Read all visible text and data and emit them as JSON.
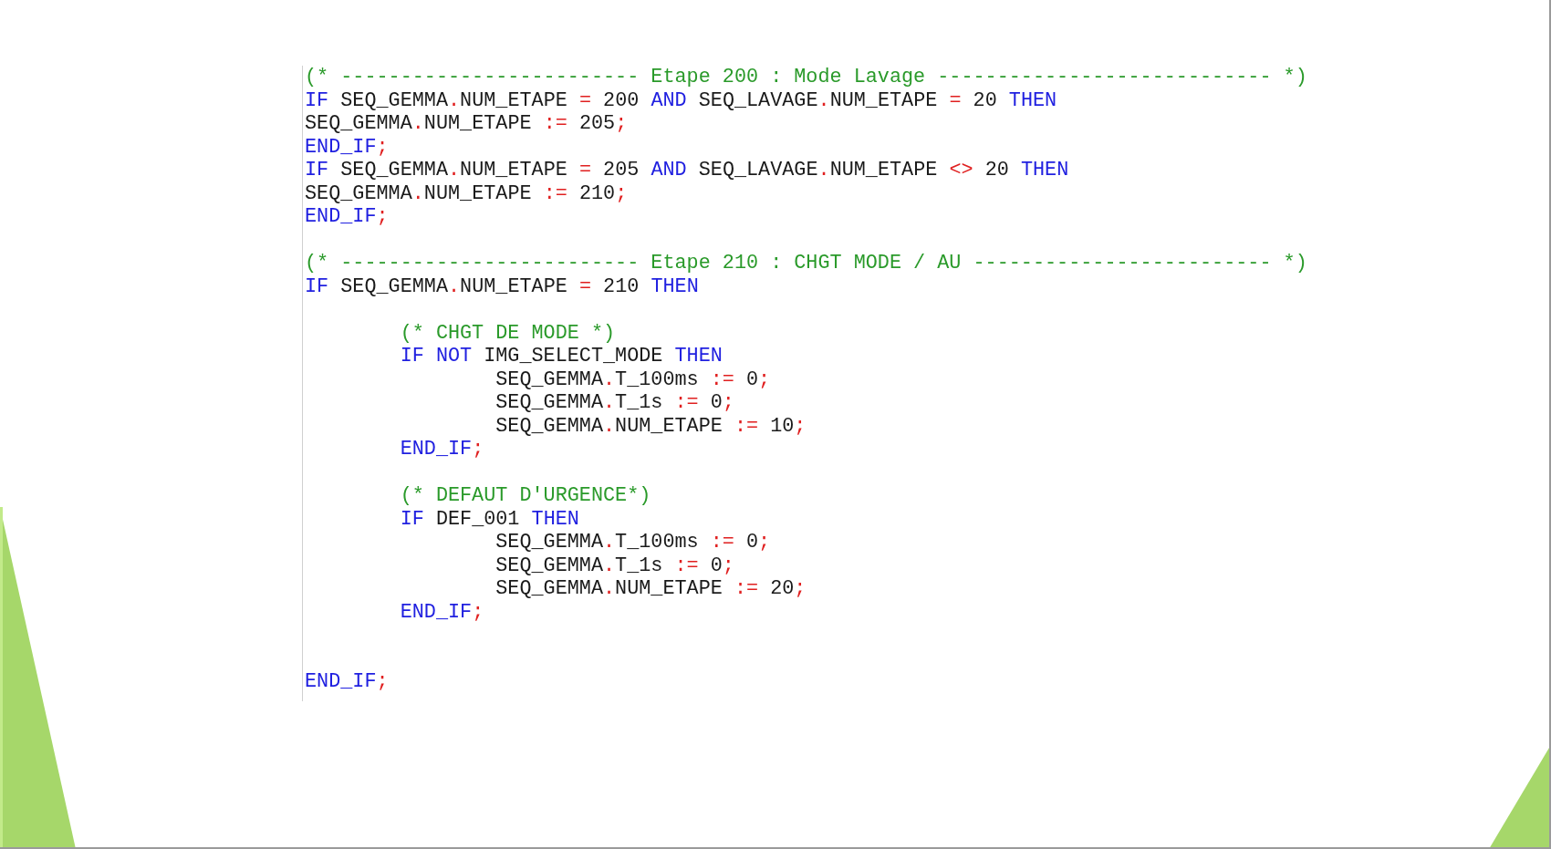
{
  "code_lines": [
    {
      "kind": "code",
      "tokens": [
        {
          "kind": "comment",
          "text": "(* ------------------------- Etape 200 : Mode Lavage ---------------------------- *)"
        }
      ]
    },
    {
      "kind": "code",
      "tokens": [
        {
          "kind": "keyword",
          "text": "IF"
        },
        {
          "kind": "plain",
          "text": " SEQ_GEMMA"
        },
        {
          "kind": "operator",
          "text": "."
        },
        {
          "kind": "plain",
          "text": "NUM_ETAPE "
        },
        {
          "kind": "operator",
          "text": "="
        },
        {
          "kind": "plain",
          "text": " 200 "
        },
        {
          "kind": "keyword",
          "text": "AND"
        },
        {
          "kind": "plain",
          "text": " SEQ_LAVAGE"
        },
        {
          "kind": "operator",
          "text": "."
        },
        {
          "kind": "plain",
          "text": "NUM_ETAPE "
        },
        {
          "kind": "operator",
          "text": "="
        },
        {
          "kind": "plain",
          "text": " 20 "
        },
        {
          "kind": "keyword",
          "text": "THEN"
        }
      ]
    },
    {
      "kind": "code",
      "tokens": [
        {
          "kind": "plain",
          "text": "SEQ_GEMMA"
        },
        {
          "kind": "operator",
          "text": "."
        },
        {
          "kind": "plain",
          "text": "NUM_ETAPE "
        },
        {
          "kind": "operator",
          "text": ":="
        },
        {
          "kind": "plain",
          "text": " 205"
        },
        {
          "kind": "operator",
          "text": ";"
        }
      ]
    },
    {
      "kind": "code",
      "tokens": [
        {
          "kind": "keyword",
          "text": "END_IF"
        },
        {
          "kind": "operator",
          "text": ";"
        }
      ]
    },
    {
      "kind": "code",
      "tokens": [
        {
          "kind": "keyword",
          "text": "IF"
        },
        {
          "kind": "plain",
          "text": " SEQ_GEMMA"
        },
        {
          "kind": "operator",
          "text": "."
        },
        {
          "kind": "plain",
          "text": "NUM_ETAPE "
        },
        {
          "kind": "operator",
          "text": "="
        },
        {
          "kind": "plain",
          "text": " 205 "
        },
        {
          "kind": "keyword",
          "text": "AND"
        },
        {
          "kind": "plain",
          "text": " SEQ_LAVAGE"
        },
        {
          "kind": "operator",
          "text": "."
        },
        {
          "kind": "plain",
          "text": "NUM_ETAPE "
        },
        {
          "kind": "operator",
          "text": "<>"
        },
        {
          "kind": "plain",
          "text": " 20 "
        },
        {
          "kind": "keyword",
          "text": "THEN"
        }
      ]
    },
    {
      "kind": "code",
      "tokens": [
        {
          "kind": "plain",
          "text": "SEQ_GEMMA"
        },
        {
          "kind": "operator",
          "text": "."
        },
        {
          "kind": "plain",
          "text": "NUM_ETAPE "
        },
        {
          "kind": "operator",
          "text": ":="
        },
        {
          "kind": "plain",
          "text": " 210"
        },
        {
          "kind": "operator",
          "text": ";"
        }
      ]
    },
    {
      "kind": "code",
      "tokens": [
        {
          "kind": "keyword",
          "text": "END_IF"
        },
        {
          "kind": "operator",
          "text": ";"
        }
      ]
    },
    {
      "kind": "blank"
    },
    {
      "kind": "code",
      "tokens": [
        {
          "kind": "comment",
          "text": "(* ------------------------- Etape 210 : CHGT MODE / AU ------------------------- *)"
        }
      ]
    },
    {
      "kind": "code",
      "tokens": [
        {
          "kind": "keyword",
          "text": "IF"
        },
        {
          "kind": "plain",
          "text": " SEQ_GEMMA"
        },
        {
          "kind": "operator",
          "text": "."
        },
        {
          "kind": "plain",
          "text": "NUM_ETAPE "
        },
        {
          "kind": "operator",
          "text": "="
        },
        {
          "kind": "plain",
          "text": " 210 "
        },
        {
          "kind": "keyword",
          "text": "THEN"
        }
      ]
    },
    {
      "kind": "blank"
    },
    {
      "kind": "code",
      "tokens": [
        {
          "kind": "comment",
          "text": "        (* CHGT DE MODE *)"
        }
      ]
    },
    {
      "kind": "code",
      "tokens": [
        {
          "kind": "keyword",
          "text": "        IF NOT"
        },
        {
          "kind": "plain",
          "text": " IMG_SELECT_MODE "
        },
        {
          "kind": "keyword",
          "text": "THEN"
        }
      ]
    },
    {
      "kind": "code",
      "tokens": [
        {
          "kind": "plain",
          "text": "                SEQ_GEMMA"
        },
        {
          "kind": "operator",
          "text": "."
        },
        {
          "kind": "plain",
          "text": "T_100ms "
        },
        {
          "kind": "operator",
          "text": ":="
        },
        {
          "kind": "plain",
          "text": " 0"
        },
        {
          "kind": "operator",
          "text": ";"
        }
      ]
    },
    {
      "kind": "code",
      "tokens": [
        {
          "kind": "plain",
          "text": "                SEQ_GEMMA"
        },
        {
          "kind": "operator",
          "text": "."
        },
        {
          "kind": "plain",
          "text": "T_1s "
        },
        {
          "kind": "operator",
          "text": ":="
        },
        {
          "kind": "plain",
          "text": " 0"
        },
        {
          "kind": "operator",
          "text": ";"
        }
      ]
    },
    {
      "kind": "code",
      "tokens": [
        {
          "kind": "plain",
          "text": "                SEQ_GEMMA"
        },
        {
          "kind": "operator",
          "text": "."
        },
        {
          "kind": "plain",
          "text": "NUM_ETAPE "
        },
        {
          "kind": "operator",
          "text": ":="
        },
        {
          "kind": "plain",
          "text": " 10"
        },
        {
          "kind": "operator",
          "text": ";"
        }
      ]
    },
    {
      "kind": "code",
      "tokens": [
        {
          "kind": "keyword",
          "text": "        END_IF"
        },
        {
          "kind": "operator",
          "text": ";"
        }
      ]
    },
    {
      "kind": "blank"
    },
    {
      "kind": "code",
      "tokens": [
        {
          "kind": "comment",
          "text": "        (* DEFAUT D'URGENCE*)"
        }
      ]
    },
    {
      "kind": "code",
      "tokens": [
        {
          "kind": "keyword",
          "text": "        IF"
        },
        {
          "kind": "plain",
          "text": " DEF_001 "
        },
        {
          "kind": "keyword",
          "text": "THEN"
        }
      ]
    },
    {
      "kind": "code",
      "tokens": [
        {
          "kind": "plain",
          "text": "                SEQ_GEMMA"
        },
        {
          "kind": "operator",
          "text": "."
        },
        {
          "kind": "plain",
          "text": "T_100ms "
        },
        {
          "kind": "operator",
          "text": ":="
        },
        {
          "kind": "plain",
          "text": " 0"
        },
        {
          "kind": "operator",
          "text": ";"
        }
      ]
    },
    {
      "kind": "code",
      "tokens": [
        {
          "kind": "plain",
          "text": "                SEQ_GEMMA"
        },
        {
          "kind": "operator",
          "text": "."
        },
        {
          "kind": "plain",
          "text": "T_1s "
        },
        {
          "kind": "operator",
          "text": ":="
        },
        {
          "kind": "plain",
          "text": " 0"
        },
        {
          "kind": "operator",
          "text": ";"
        }
      ]
    },
    {
      "kind": "code",
      "tokens": [
        {
          "kind": "plain",
          "text": "                SEQ_GEMMA"
        },
        {
          "kind": "operator",
          "text": "."
        },
        {
          "kind": "plain",
          "text": "NUM_ETAPE "
        },
        {
          "kind": "operator",
          "text": ":="
        },
        {
          "kind": "plain",
          "text": " 20"
        },
        {
          "kind": "operator",
          "text": ";"
        }
      ]
    },
    {
      "kind": "code",
      "tokens": [
        {
          "kind": "keyword",
          "text": "        END_IF"
        },
        {
          "kind": "operator",
          "text": ";"
        }
      ]
    },
    {
      "kind": "blank"
    },
    {
      "kind": "blank"
    },
    {
      "kind": "code",
      "tokens": [
        {
          "kind": "keyword",
          "text": "END_IF"
        },
        {
          "kind": "operator",
          "text": ";"
        }
      ]
    }
  ]
}
